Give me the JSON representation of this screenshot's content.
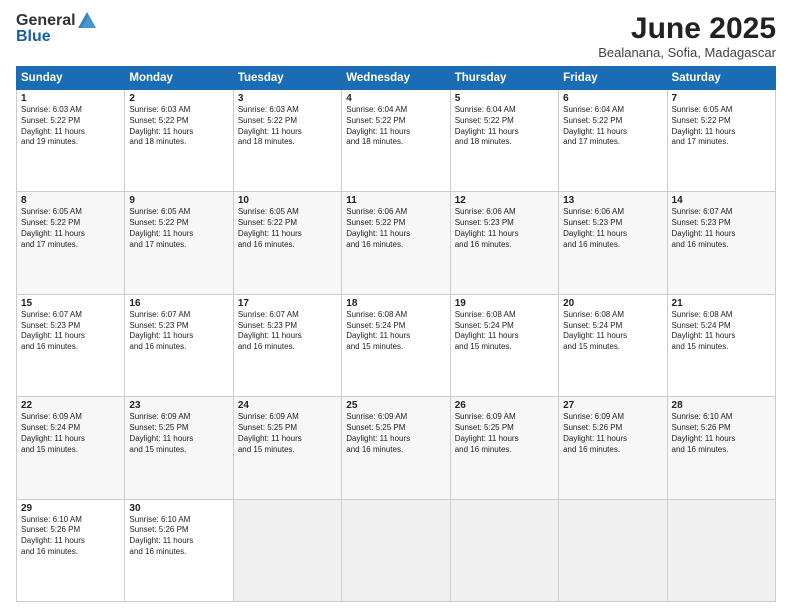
{
  "logo": {
    "text_general": "General",
    "text_blue": "Blue"
  },
  "title": {
    "main": "June 2025",
    "sub": "Bealanana, Sofia, Madagascar"
  },
  "calendar": {
    "headers": [
      "Sunday",
      "Monday",
      "Tuesday",
      "Wednesday",
      "Thursday",
      "Friday",
      "Saturday"
    ],
    "weeks": [
      [
        {
          "day": "",
          "info": ""
        },
        {
          "day": "2",
          "info": "Sunrise: 6:03 AM\nSunset: 5:22 PM\nDaylight: 11 hours\nand 18 minutes."
        },
        {
          "day": "3",
          "info": "Sunrise: 6:03 AM\nSunset: 5:22 PM\nDaylight: 11 hours\nand 18 minutes."
        },
        {
          "day": "4",
          "info": "Sunrise: 6:04 AM\nSunset: 5:22 PM\nDaylight: 11 hours\nand 18 minutes."
        },
        {
          "day": "5",
          "info": "Sunrise: 6:04 AM\nSunset: 5:22 PM\nDaylight: 11 hours\nand 18 minutes."
        },
        {
          "day": "6",
          "info": "Sunrise: 6:04 AM\nSunset: 5:22 PM\nDaylight: 11 hours\nand 17 minutes."
        },
        {
          "day": "7",
          "info": "Sunrise: 6:05 AM\nSunset: 5:22 PM\nDaylight: 11 hours\nand 17 minutes."
        }
      ],
      [
        {
          "day": "1",
          "info": "Sunrise: 6:03 AM\nSunset: 5:22 PM\nDaylight: 11 hours\nand 19 minutes."
        },
        null,
        null,
        null,
        null,
        null,
        null
      ],
      [
        {
          "day": "8",
          "info": "Sunrise: 6:05 AM\nSunset: 5:22 PM\nDaylight: 11 hours\nand 17 minutes."
        },
        {
          "day": "9",
          "info": "Sunrise: 6:05 AM\nSunset: 5:22 PM\nDaylight: 11 hours\nand 17 minutes."
        },
        {
          "day": "10",
          "info": "Sunrise: 6:05 AM\nSunset: 5:22 PM\nDaylight: 11 hours\nand 16 minutes."
        },
        {
          "day": "11",
          "info": "Sunrise: 6:06 AM\nSunset: 5:22 PM\nDaylight: 11 hours\nand 16 minutes."
        },
        {
          "day": "12",
          "info": "Sunrise: 6:06 AM\nSunset: 5:23 PM\nDaylight: 11 hours\nand 16 minutes."
        },
        {
          "day": "13",
          "info": "Sunrise: 6:06 AM\nSunset: 5:23 PM\nDaylight: 11 hours\nand 16 minutes."
        },
        {
          "day": "14",
          "info": "Sunrise: 6:07 AM\nSunset: 5:23 PM\nDaylight: 11 hours\nand 16 minutes."
        }
      ],
      [
        {
          "day": "15",
          "info": "Sunrise: 6:07 AM\nSunset: 5:23 PM\nDaylight: 11 hours\nand 16 minutes."
        },
        {
          "day": "16",
          "info": "Sunrise: 6:07 AM\nSunset: 5:23 PM\nDaylight: 11 hours\nand 16 minutes."
        },
        {
          "day": "17",
          "info": "Sunrise: 6:07 AM\nSunset: 5:23 PM\nDaylight: 11 hours\nand 16 minutes."
        },
        {
          "day": "18",
          "info": "Sunrise: 6:08 AM\nSunset: 5:24 PM\nDaylight: 11 hours\nand 15 minutes."
        },
        {
          "day": "19",
          "info": "Sunrise: 6:08 AM\nSunset: 5:24 PM\nDaylight: 11 hours\nand 15 minutes."
        },
        {
          "day": "20",
          "info": "Sunrise: 6:08 AM\nSunset: 5:24 PM\nDaylight: 11 hours\nand 15 minutes."
        },
        {
          "day": "21",
          "info": "Sunrise: 6:08 AM\nSunset: 5:24 PM\nDaylight: 11 hours\nand 15 minutes."
        }
      ],
      [
        {
          "day": "22",
          "info": "Sunrise: 6:09 AM\nSunset: 5:24 PM\nDaylight: 11 hours\nand 15 minutes."
        },
        {
          "day": "23",
          "info": "Sunrise: 6:09 AM\nSunset: 5:25 PM\nDaylight: 11 hours\nand 15 minutes."
        },
        {
          "day": "24",
          "info": "Sunrise: 6:09 AM\nSunset: 5:25 PM\nDaylight: 11 hours\nand 15 minutes."
        },
        {
          "day": "25",
          "info": "Sunrise: 6:09 AM\nSunset: 5:25 PM\nDaylight: 11 hours\nand 16 minutes."
        },
        {
          "day": "26",
          "info": "Sunrise: 6:09 AM\nSunset: 5:25 PM\nDaylight: 11 hours\nand 16 minutes."
        },
        {
          "day": "27",
          "info": "Sunrise: 6:09 AM\nSunset: 5:26 PM\nDaylight: 11 hours\nand 16 minutes."
        },
        {
          "day": "28",
          "info": "Sunrise: 6:10 AM\nSunset: 5:26 PM\nDaylight: 11 hours\nand 16 minutes."
        }
      ],
      [
        {
          "day": "29",
          "info": "Sunrise: 6:10 AM\nSunset: 5:26 PM\nDaylight: 11 hours\nand 16 minutes."
        },
        {
          "day": "30",
          "info": "Sunrise: 6:10 AM\nSunset: 5:26 PM\nDaylight: 11 hours\nand 16 minutes."
        },
        {
          "day": "",
          "info": ""
        },
        {
          "day": "",
          "info": ""
        },
        {
          "day": "",
          "info": ""
        },
        {
          "day": "",
          "info": ""
        },
        {
          "day": "",
          "info": ""
        }
      ]
    ]
  }
}
